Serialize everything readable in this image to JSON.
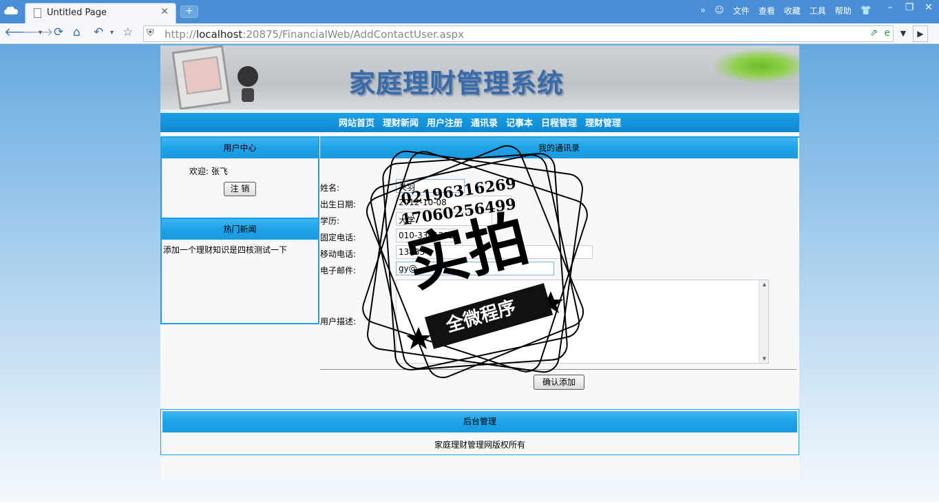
{
  "browser": {
    "tab_title": "Untitled Page",
    "new_tab_symbol": "+",
    "url_prefix": "http://",
    "url_host": "localhost",
    "url_rest": ":20875/FinancialWeb/AddContactUser.aspx",
    "menus": [
      "文件",
      "查看",
      "收藏",
      "工具",
      "帮助"
    ]
  },
  "site": {
    "title": "家庭理财管理系统",
    "nav": [
      "网站首页",
      "理财新闻",
      "用户注册",
      "通讯录",
      "记事本",
      "日程管理",
      "理财管理"
    ]
  },
  "user_center": {
    "heading": "用户中心",
    "welcome": "欢迎: 张飞",
    "logout_label": "注 销"
  },
  "hot_news": {
    "heading": "热门新闻",
    "items": [
      "添加一个理财知识是四核测试一下"
    ]
  },
  "contact_form": {
    "heading": "我的通讯录",
    "fields": [
      {
        "label": "姓名:",
        "value": "关羽"
      },
      {
        "label": "出生日期:",
        "value": "2012-10-08"
      },
      {
        "label": "学历:",
        "value": "大学"
      },
      {
        "label": "固定电话:",
        "value": "010-33412322"
      },
      {
        "label": "移动电话:",
        "value": "13833"
      },
      {
        "label": "电子邮件:",
        "value": "gy@"
      }
    ],
    "description_label": "用户描述:",
    "description_value": "",
    "submit_label": "确认添加"
  },
  "footer": {
    "heading": "后台管理",
    "copyright": "家庭理财管理网版权所有"
  },
  "watermark": {
    "phone1": "02196316269",
    "phone2": "17060256499",
    "main": "实拍",
    "sub": "全微程序"
  }
}
